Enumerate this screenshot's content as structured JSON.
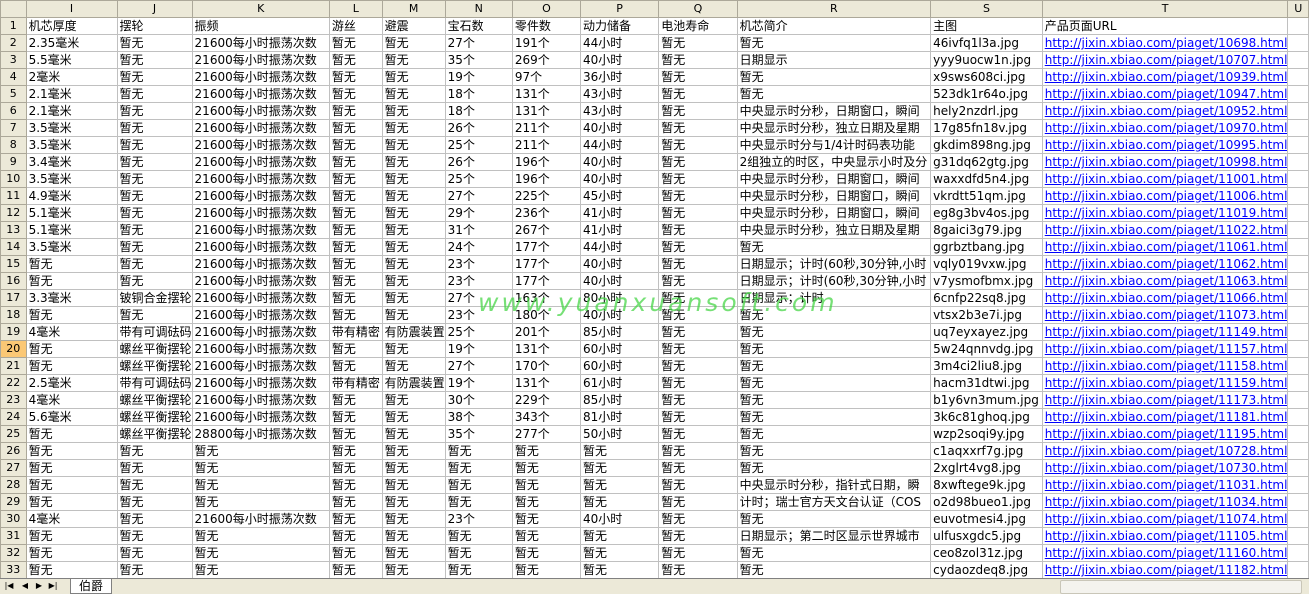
{
  "columns": [
    "I",
    "J",
    "K",
    "L",
    "M",
    "N",
    "O",
    "P",
    "Q",
    "R",
    "S",
    "T",
    "U"
  ],
  "header_row": {
    "num": "1",
    "cells": [
      "机芯厚度",
      "摆轮",
      "振频",
      "游丝",
      "避震",
      "宝石数",
      "零件数",
      "动力储备",
      "电池寿命",
      "机芯简介",
      "主图",
      "产品页面URL",
      ""
    ]
  },
  "rows": [
    {
      "num": "2",
      "cells": [
        "2.35毫米",
        "暂无",
        "21600每小时振荡次数",
        "暂无",
        "暂无",
        "27个",
        "191个",
        "44小时",
        "暂无",
        "暂无",
        "46ivfq1l3a.jpg",
        "http://jixin.xbiao.com/piaget/10698.html",
        ""
      ]
    },
    {
      "num": "3",
      "cells": [
        "5.5毫米",
        "暂无",
        "21600每小时振荡次数",
        "暂无",
        "暂无",
        "35个",
        "269个",
        "40小时",
        "暂无",
        "日期显示",
        "yyy9uocw1n.jpg",
        "http://jixin.xbiao.com/piaget/10707.html",
        ""
      ]
    },
    {
      "num": "4",
      "cells": [
        "2毫米",
        "暂无",
        "21600每小时振荡次数",
        "暂无",
        "暂无",
        "19个",
        "97个",
        "36小时",
        "暂无",
        "暂无",
        "x9sws608ci.jpg",
        "http://jixin.xbiao.com/piaget/10939.html",
        ""
      ]
    },
    {
      "num": "5",
      "cells": [
        "2.1毫米",
        "暂无",
        "21600每小时振荡次数",
        "暂无",
        "暂无",
        "18个",
        "131个",
        "43小时",
        "暂无",
        "暂无",
        "523dk1r64o.jpg",
        "http://jixin.xbiao.com/piaget/10947.html",
        ""
      ]
    },
    {
      "num": "6",
      "cells": [
        "2.1毫米",
        "暂无",
        "21600每小时振荡次数",
        "暂无",
        "暂无",
        "18个",
        "131个",
        "43小时",
        "暂无",
        "中央显示时分秒，日期窗口，瞬间",
        "hely2nzdrl.jpg",
        "http://jixin.xbiao.com/piaget/10952.html",
        ""
      ]
    },
    {
      "num": "7",
      "cells": [
        "3.5毫米",
        "暂无",
        "21600每小时振荡次数",
        "暂无",
        "暂无",
        "26个",
        "211个",
        "40小时",
        "暂无",
        "中央显示时分秒，独立日期及星期",
        "17g85fn18v.jpg",
        "http://jixin.xbiao.com/piaget/10970.html",
        ""
      ]
    },
    {
      "num": "8",
      "cells": [
        "3.5毫米",
        "暂无",
        "21600每小时振荡次数",
        "暂无",
        "暂无",
        "25个",
        "211个",
        "44小时",
        "暂无",
        "中央显示时分与1/4计时码表功能",
        "gkdim898ng.jpg",
        "http://jixin.xbiao.com/piaget/10995.html",
        ""
      ]
    },
    {
      "num": "9",
      "cells": [
        "3.4毫米",
        "暂无",
        "21600每小时振荡次数",
        "暂无",
        "暂无",
        "26个",
        "196个",
        "40小时",
        "暂无",
        "2组独立的时区，中央显示小时及分",
        "g31dq62gtg.jpg",
        "http://jixin.xbiao.com/piaget/10998.html",
        ""
      ]
    },
    {
      "num": "10",
      "cells": [
        "3.5毫米",
        "暂无",
        "21600每小时振荡次数",
        "暂无",
        "暂无",
        "25个",
        "196个",
        "40小时",
        "暂无",
        "中央显示时分秒，日期窗口，瞬间",
        "waxxdfd5n4.jpg",
        "http://jixin.xbiao.com/piaget/11001.html",
        ""
      ]
    },
    {
      "num": "11",
      "cells": [
        "4.9毫米",
        "暂无",
        "21600每小时振荡次数",
        "暂无",
        "暂无",
        "27个",
        "225个",
        "45小时",
        "暂无",
        "中央显示时分秒，日期窗口，瞬间",
        "vkrdtt51qm.jpg",
        "http://jixin.xbiao.com/piaget/11006.html",
        ""
      ]
    },
    {
      "num": "12",
      "cells": [
        "5.1毫米",
        "暂无",
        "21600每小时振荡次数",
        "暂无",
        "暂无",
        "29个",
        "236个",
        "41小时",
        "暂无",
        "中央显示时分秒，日期窗口，瞬间",
        "eg8g3bv4os.jpg",
        "http://jixin.xbiao.com/piaget/11019.html",
        ""
      ]
    },
    {
      "num": "13",
      "cells": [
        "5.1毫米",
        "暂无",
        "21600每小时振荡次数",
        "暂无",
        "暂无",
        "31个",
        "267个",
        "41小时",
        "暂无",
        "中央显示时分秒，独立日期及星期",
        "8gaici3g79.jpg",
        "http://jixin.xbiao.com/piaget/11022.html",
        ""
      ]
    },
    {
      "num": "14",
      "cells": [
        "3.5毫米",
        "暂无",
        "21600每小时振荡次数",
        "暂无",
        "暂无",
        "24个",
        "177个",
        "44小时",
        "暂无",
        "暂无",
        "ggrbztbang.jpg",
        "http://jixin.xbiao.com/piaget/11061.html",
        ""
      ]
    },
    {
      "num": "15",
      "cells": [
        "暂无",
        "暂无",
        "21600每小时振荡次数",
        "暂无",
        "暂无",
        "23个",
        "177个",
        "40小时",
        "暂无",
        "日期显示；计时(60秒,30分钟,小时",
        "vqly019vxw.jpg",
        "http://jixin.xbiao.com/piaget/11062.html",
        ""
      ]
    },
    {
      "num": "16",
      "cells": [
        "暂无",
        "暂无",
        "21600每小时振荡次数",
        "暂无",
        "暂无",
        "23个",
        "177个",
        "40小时",
        "暂无",
        "日期显示；计时(60秒,30分钟,小时",
        "v7ysmofbmx.jpg",
        "http://jixin.xbiao.com/piaget/11063.html",
        ""
      ]
    },
    {
      "num": "17",
      "cells": [
        "3.3毫米",
        "铍铜合金摆轮",
        "21600每小时振荡次数",
        "暂无",
        "暂无",
        "27个",
        "163个",
        "80小时",
        "暂无",
        "日期显示；计时",
        "6cnfp22sq8.jpg",
        "http://jixin.xbiao.com/piaget/11066.html",
        ""
      ]
    },
    {
      "num": "18",
      "cells": [
        "暂无",
        "暂无",
        "21600每小时振荡次数",
        "暂无",
        "暂无",
        "23个",
        "180个",
        "40小时",
        "暂无",
        "暂无",
        "vtsx2b3e7i.jpg",
        "http://jixin.xbiao.com/piaget/11073.html",
        ""
      ]
    },
    {
      "num": "19",
      "cells": [
        "4毫米",
        "带有可调砝码",
        "21600每小时振荡次数",
        "带有精密",
        "有防震装置",
        "25个",
        "201个",
        "85小时",
        "暂无",
        "暂无",
        "uq7eyxayez.jpg",
        "http://jixin.xbiao.com/piaget/11149.html",
        ""
      ]
    },
    {
      "num": "20",
      "cells": [
        "暂无",
        "螺丝平衡摆轮",
        "21600每小时振荡次数",
        "暂无",
        "暂无",
        "19个",
        "131个",
        "60小时",
        "暂无",
        "暂无",
        "5w24qnnvdg.jpg",
        "http://jixin.xbiao.com/piaget/11157.html",
        ""
      ]
    },
    {
      "num": "21",
      "cells": [
        "暂无",
        "螺丝平衡摆轮",
        "21600每小时振荡次数",
        "暂无",
        "暂无",
        "27个",
        "170个",
        "60小时",
        "暂无",
        "暂无",
        "3m4ci2liu8.jpg",
        "http://jixin.xbiao.com/piaget/11158.html",
        ""
      ]
    },
    {
      "num": "22",
      "cells": [
        "2.5毫米",
        "带有可调砝码",
        "21600每小时振荡次数",
        "带有精密",
        "有防震装置",
        "19个",
        "131个",
        "61小时",
        "暂无",
        "暂无",
        "hacm31dtwi.jpg",
        "http://jixin.xbiao.com/piaget/11159.html",
        ""
      ]
    },
    {
      "num": "23",
      "cells": [
        "4毫米",
        "螺丝平衡摆轮",
        "21600每小时振荡次数",
        "暂无",
        "暂无",
        "30个",
        "229个",
        "85小时",
        "暂无",
        "暂无",
        "b1y6vn3mum.jpg",
        "http://jixin.xbiao.com/piaget/11173.html",
        ""
      ]
    },
    {
      "num": "24",
      "cells": [
        "5.6毫米",
        "螺丝平衡摆轮",
        "21600每小时振荡次数",
        "暂无",
        "暂无",
        "38个",
        "343个",
        "81小时",
        "暂无",
        "暂无",
        "3k6c81ghoq.jpg",
        "http://jixin.xbiao.com/piaget/11181.html",
        ""
      ]
    },
    {
      "num": "25",
      "cells": [
        "暂无",
        "螺丝平衡摆轮",
        "28800每小时振荡次数",
        "暂无",
        "暂无",
        "35个",
        "277个",
        "50小时",
        "暂无",
        "暂无",
        "wzp2soqi9y.jpg",
        "http://jixin.xbiao.com/piaget/11195.html",
        ""
      ]
    },
    {
      "num": "26",
      "cells": [
        "暂无",
        "暂无",
        "暂无",
        "暂无",
        "暂无",
        "暂无",
        "暂无",
        "暂无",
        "暂无",
        "暂无",
        "c1aqxxrf7g.jpg",
        "http://jixin.xbiao.com/piaget/10728.html",
        ""
      ]
    },
    {
      "num": "27",
      "cells": [
        "暂无",
        "暂无",
        "暂无",
        "暂无",
        "暂无",
        "暂无",
        "暂无",
        "暂无",
        "暂无",
        "暂无",
        "2xglrt4vg8.jpg",
        "http://jixin.xbiao.com/piaget/10730.html",
        ""
      ]
    },
    {
      "num": "28",
      "cells": [
        "暂无",
        "暂无",
        "暂无",
        "暂无",
        "暂无",
        "暂无",
        "暂无",
        "暂无",
        "暂无",
        "中央显示时分秒，指针式日期，瞬",
        "8xwftege9k.jpg",
        "http://jixin.xbiao.com/piaget/11031.html",
        ""
      ]
    },
    {
      "num": "29",
      "cells": [
        "暂无",
        "暂无",
        "暂无",
        "暂无",
        "暂无",
        "暂无",
        "暂无",
        "暂无",
        "暂无",
        "计时；瑞士官方天文台认证（COS",
        "o2d98bueo1.jpg",
        "http://jixin.xbiao.com/piaget/11034.html",
        ""
      ]
    },
    {
      "num": "30",
      "cells": [
        "4毫米",
        "暂无",
        "21600每小时振荡次数",
        "暂无",
        "暂无",
        "23个",
        "暂无",
        "40小时",
        "暂无",
        "暂无",
        "euvotmesi4.jpg",
        "http://jixin.xbiao.com/piaget/11074.html",
        ""
      ]
    },
    {
      "num": "31",
      "cells": [
        "暂无",
        "暂无",
        "暂无",
        "暂无",
        "暂无",
        "暂无",
        "暂无",
        "暂无",
        "暂无",
        "日期显示；第二时区显示世界城市",
        "ulfusxgdc5.jpg",
        "http://jixin.xbiao.com/piaget/11105.html",
        ""
      ]
    },
    {
      "num": "32",
      "cells": [
        "暂无",
        "暂无",
        "暂无",
        "暂无",
        "暂无",
        "暂无",
        "暂无",
        "暂无",
        "暂无",
        "暂无",
        "ceo8zol31z.jpg",
        "http://jixin.xbiao.com/piaget/11160.html",
        ""
      ]
    },
    {
      "num": "33",
      "cells": [
        "暂无",
        "暂无",
        "暂无",
        "暂无",
        "暂无",
        "暂无",
        "暂无",
        "暂无",
        "暂无",
        "暂无",
        "cydaozdeq8.jpg",
        "http://jixin.xbiao.com/piaget/11182.html",
        ""
      ]
    }
  ],
  "watermark": "www.yuanxuansoft.com",
  "sheet_tab": "伯爵",
  "colors": {
    "link": "#0000ff",
    "header_bg": "#ece9d8",
    "active_row": "#fbc875",
    "watermark": "#49d649"
  }
}
